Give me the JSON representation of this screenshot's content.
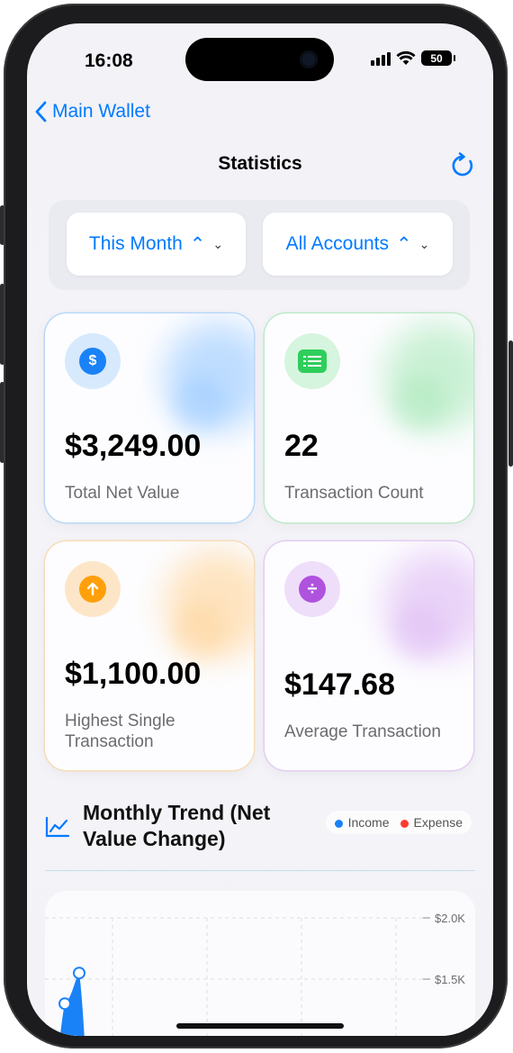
{
  "status": {
    "time": "16:08",
    "battery": "50"
  },
  "nav": {
    "back_label": "Main Wallet",
    "title": "Statistics"
  },
  "filters": {
    "period": "This Month",
    "accounts": "All Accounts"
  },
  "cards": [
    {
      "value": "$3,249.00",
      "label": "Total Net Value",
      "icon": "dollar-icon",
      "color": "#1a82f7"
    },
    {
      "value": "22",
      "label": "Transaction Count",
      "icon": "list-icon",
      "color": "#2fce5c"
    },
    {
      "value": "$1,100.00",
      "label": "Highest Single Transaction",
      "icon": "arrow-up-icon",
      "color": "#ff9f0a"
    },
    {
      "value": "$147.68",
      "label": "Average Transaction",
      "icon": "divide-icon",
      "color": "#af52de"
    }
  ],
  "trend": {
    "title": "Monthly Trend (Net Value Change)",
    "legend": {
      "income": "Income",
      "expense": "Expense",
      "income_color": "#1a82f7",
      "expense_color": "#ff3b30"
    }
  },
  "chart_data": {
    "type": "line",
    "title": "",
    "y_tick_labels": [
      "$2.0K",
      "$1.5K"
    ],
    "series": [
      {
        "name": "Income",
        "values": [
          1300,
          1550
        ]
      }
    ]
  }
}
